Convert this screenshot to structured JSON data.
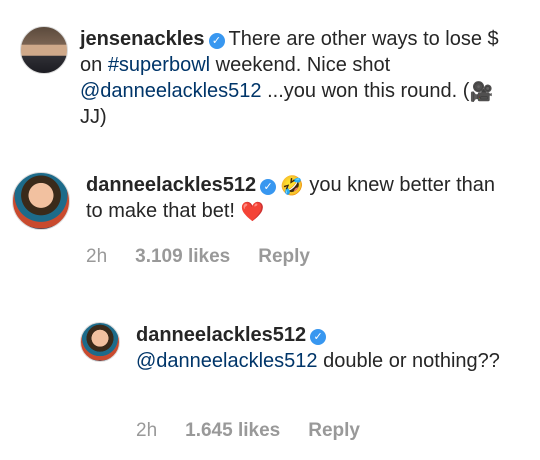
{
  "comments": [
    {
      "username": "jensenackles",
      "verified_icon": "check-icon",
      "segments": [
        {
          "text": "There are other ways to lose $ on ",
          "type": "text"
        },
        {
          "text": "#superbowl",
          "type": "link"
        },
        {
          "text": " weekend.  Nice shot ",
          "type": "text"
        },
        {
          "text": "@danneelackles512",
          "type": "link"
        },
        {
          "text": " ...you won this round. (",
          "type": "text"
        },
        {
          "text": "🎥",
          "type": "emoji"
        },
        {
          "text": " JJ)",
          "type": "text"
        }
      ]
    },
    {
      "username": "danneelackles512",
      "verified_icon": "check-icon",
      "segments": [
        {
          "text": "🤣",
          "type": "emoji"
        },
        {
          "text": " you knew better than to make that bet! ",
          "type": "text"
        },
        {
          "text": "❤️",
          "type": "emoji"
        }
      ],
      "time": "2h",
      "likes": "3.109 likes",
      "reply": "Reply"
    },
    {
      "username": "danneelackles512",
      "verified_icon": "check-icon",
      "segments": [
        {
          "text": "@danneelackles512",
          "type": "link"
        },
        {
          "text": " double or nothing??",
          "type": "text"
        }
      ],
      "time": "2h",
      "likes": "1.645 likes",
      "reply": "Reply"
    }
  ],
  "colors": {
    "verified": "#3897f0",
    "link": "#003569",
    "meta": "#999999",
    "heart": "#ed4956"
  }
}
